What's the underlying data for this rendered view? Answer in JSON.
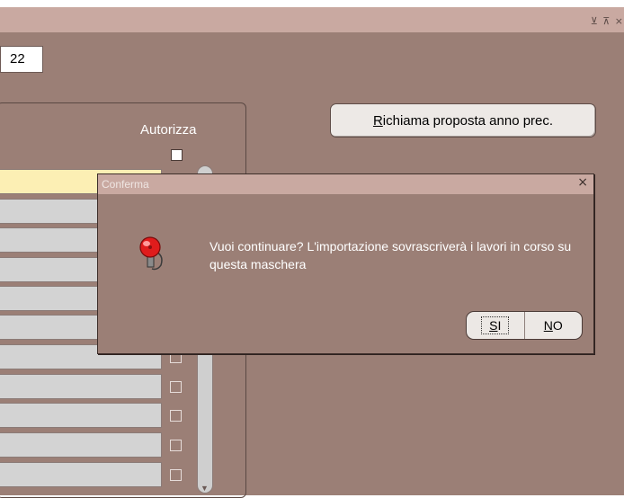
{
  "window": {
    "controls": "⊻ ⊼ ×"
  },
  "form": {
    "year_value": "22",
    "column_header": "Autorizza",
    "recall_button": {
      "mnemonic": "R",
      "rest": "ichiama proposta anno prec."
    }
  },
  "dialog": {
    "title": "Conferma",
    "close": "×",
    "message": "Vuoi continuare? L'importazione sovrascriverà i lavori in corso su questa maschera",
    "yes": {
      "mnemonic": "S",
      "rest": "I"
    },
    "no": {
      "mnemonic": "N",
      "rest": "O"
    }
  },
  "colors": {
    "background": "#9b7f76",
    "titlebar": "#c9a9a1",
    "selected_row": "#fcefb4",
    "field": "#d3d3d3"
  }
}
